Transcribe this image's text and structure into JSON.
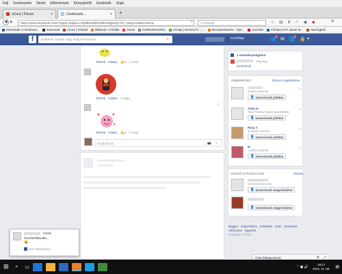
{
  "menu": [
    "Fájl",
    "Szerkesztés",
    "Nézet",
    "Előzmények",
    "Könyvjelzők",
    "Eszközök",
    "Súgó"
  ],
  "tabs": [
    {
      "label": "nCore | Fórum"
    },
    {
      "label": "Üzetkeszle..."
    }
  ],
  "tab_close": "×",
  "new_tab": "+",
  "url": "https://www.facebook.com/?stype=lo&jlou=Afg8lEZadMTqBbentqjtmQ1Yfn_mMgA1taB0Cw8mp",
  "search_placeholder": "Keresés",
  "bookmarks": [
    "Üdvözlünk a Facebook...",
    "iHeeenatt",
    "nCore | Főoldal",
    "Bitfeeds > Főoldal",
    "Gmail",
    "HARDVERAPRO",
    "Címlap | NOSALTY – ...",
    "Receptneked.hu - Kipr...",
    "YouTube",
    "Főoldal | RTL Most! M...",
    "Hamfogleló"
  ],
  "fb": {
    "search_placeholder": "Emberek, helyek vagy dolgok keresése",
    "home_label": "Kezdőlap",
    "friend_badge": "1",
    "notif_badge": "1"
  },
  "feed": {
    "comment1": {
      "like": "Tetszik",
      "reply": "Válasz",
      "likes": "1",
      "time": "4 órája"
    },
    "comment2": {
      "like": "Tetszik",
      "reply": "Válasz",
      "time": "4 órája"
    },
    "comment3": {
      "like": "Tetszik",
      "reply": "Válasz",
      "likes": "1",
      "time": "4 órája"
    },
    "write_placeholder": "Szólj hozzá..."
  },
  "sidebar": {
    "invites_title": "1 eseménymeghívó",
    "invite_sub": "még egy",
    "invite_sub2": "ismerőssel",
    "pymk_title": "ISMERHETEK?",
    "pymk_link": "Összes megtekintése",
    "people": [
      {
        "name": "",
        "meta": "5 közös ismerős",
        "button": "Ismerősnek jelölöm"
      },
      {
        "name": "Anita H.",
        "meta": "Tibor Pásztor közös ismerősötök",
        "button": "Ismerősnek jelölöm"
      },
      {
        "name": "Pista T.",
        "meta": "11 közös ismerős",
        "button": "Ismerősnek jelölöm"
      },
      {
        "name": "M",
        "meta": "1 közös ismerős",
        "button": "Ismerősnek jelölöm"
      }
    ],
    "requests_title": "FÜGGŐ KAPCSOLATOK",
    "requests_link": "Összes",
    "requests": [
      {
        "meta": "304 közös ismerős",
        "button": "Ismerősnek megerősítése"
      },
      {
        "meta": "",
        "button": "Ismerősnek megerősítése"
      }
    ],
    "footer": [
      "Magyar",
      "Adatvédelem",
      "Feltételek",
      "Sütik",
      "Hirdetések",
      "AdChoices",
      "Egyebek"
    ],
    "copyright": "Facebook © 2015"
  },
  "chat": {
    "label": "Chat (kikapcsolva)"
  },
  "notif_popup": {
    "line1": "hozzá",
    "line2": "hozzászólásodat „",
    "source": "par mátyásjanne"
  },
  "taskbar": {
    "time": "18:17",
    "date": "2015. 11. 08."
  },
  "colors": {
    "fb_blue": "#3b5998",
    "link": "#365899",
    "taskbar": "#101010"
  }
}
